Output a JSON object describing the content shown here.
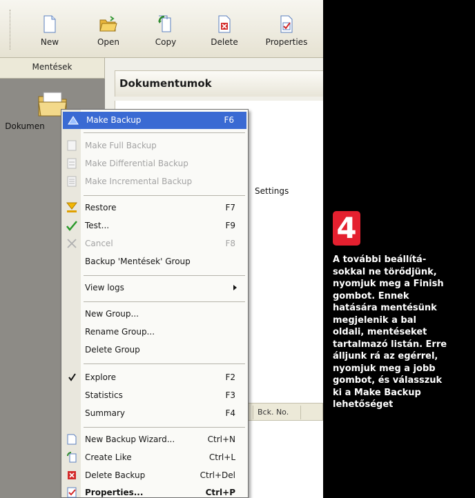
{
  "toolbar": {
    "buttons": [
      {
        "label": "New",
        "icon": "new-document-icon"
      },
      {
        "label": "Open",
        "icon": "open-folder-icon"
      },
      {
        "label": "Copy",
        "icon": "copy-icon"
      },
      {
        "label": "Delete",
        "icon": "delete-icon"
      },
      {
        "label": "Properties",
        "icon": "properties-icon"
      }
    ]
  },
  "sidebar": {
    "header": "Mentések",
    "item_label": "Dokumentumok",
    "item_label_visible": "Dokumen"
  },
  "main": {
    "panel_title": "Dokumentumok",
    "settings_text": "Settings",
    "column_bck": "Bck. No."
  },
  "menu": {
    "items": [
      {
        "label": "Make Backup",
        "shortcut": "F6",
        "state": "highlighted",
        "icon": "backup-icon"
      },
      {
        "label": "Make Full Backup",
        "shortcut": "",
        "state": "disabled",
        "icon": "full-backup-icon"
      },
      {
        "label": "Make Differential Backup",
        "shortcut": "",
        "state": "disabled",
        "icon": "differential-backup-icon"
      },
      {
        "label": "Make Incremental Backup",
        "shortcut": "",
        "state": "disabled",
        "icon": "incremental-backup-icon"
      },
      {
        "label": "Restore",
        "shortcut": "F7",
        "state": "normal",
        "icon": "restore-icon"
      },
      {
        "label": "Test...",
        "shortcut": "F9",
        "state": "normal",
        "icon": "check-icon"
      },
      {
        "label": "Cancel",
        "shortcut": "F8",
        "state": "disabled",
        "icon": "cancel-icon"
      },
      {
        "label": "Backup 'Mentések' Group",
        "shortcut": "",
        "state": "normal"
      },
      {
        "label": "View logs",
        "shortcut": "",
        "state": "normal",
        "submenu": true
      },
      {
        "label": "New Group...",
        "shortcut": "",
        "state": "normal"
      },
      {
        "label": "Rename Group...",
        "shortcut": "",
        "state": "normal"
      },
      {
        "label": "Delete Group",
        "shortcut": "",
        "state": "normal"
      },
      {
        "label": "Explore",
        "shortcut": "F2",
        "state": "checked"
      },
      {
        "label": "Statistics",
        "shortcut": "F3",
        "state": "normal"
      },
      {
        "label": "Summary",
        "shortcut": "F4",
        "state": "normal"
      },
      {
        "label": "New Backup Wizard...",
        "shortcut": "Ctrl+N",
        "state": "normal",
        "icon": "wizard-icon"
      },
      {
        "label": "Create Like",
        "shortcut": "Ctrl+L",
        "state": "normal",
        "icon": "create-like-icon"
      },
      {
        "label": "Delete Backup",
        "shortcut": "Ctrl+Del",
        "state": "normal",
        "icon": "delete-backup-icon"
      },
      {
        "label": "Properties...",
        "shortcut": "Ctrl+P",
        "state": "bold",
        "icon": "properties-icon"
      }
    ]
  },
  "caption": {
    "step": "4",
    "lines": [
      "A további beállítá-",
      "sokkal ne törődjünk,",
      "nyomjuk meg a Finish",
      "gombot. Ennek",
      "hatására mentésünk",
      "megjelenik a bal",
      "oldali, mentéseket",
      "tartalmazó listán. Erre",
      "álljunk rá az egérrel,",
      "nyomjuk meg a jobb",
      "gombot, és válasszuk",
      "ki a Make Backup",
      "lehetőséget"
    ]
  },
  "colors": {
    "highlight": "#3a6ad3",
    "badge": "#e4202f",
    "sidebar": "#8d8b86"
  }
}
